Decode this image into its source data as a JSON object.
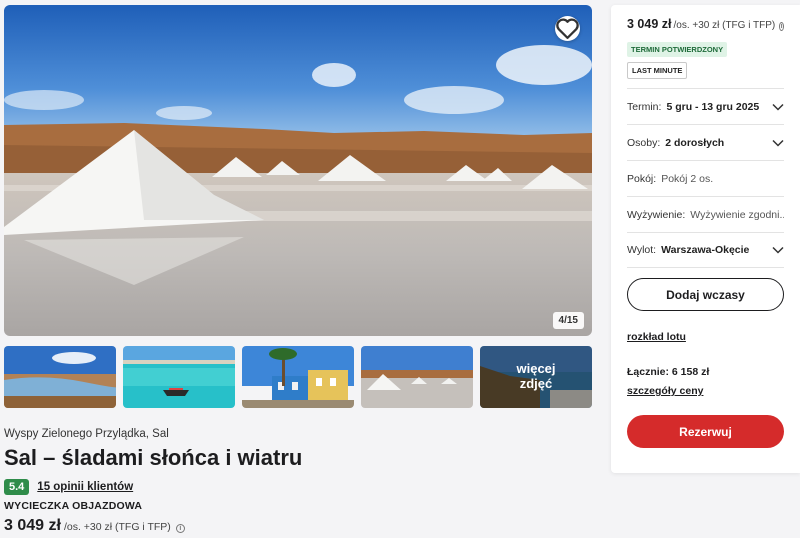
{
  "gallery": {
    "counter": "4/15",
    "more_photos_line1": "więcej",
    "more_photos_line2": "zdjęć"
  },
  "offer": {
    "location": "Wyspy Zielonego Przylądka, Sal",
    "title": "Sal – śladami słońca i wiatru",
    "rating": "5.4",
    "reviews_label": "15 opinii klientów",
    "trip_type": "WYCIECZKA OBJAZDOWA",
    "price": "3 049 zł",
    "price_suffix": "/os. +30 zł (TFG i TFP)"
  },
  "panel": {
    "price": "3 049 zł",
    "price_suffix": "/os. +30 zł (TFG i TFP)",
    "badge_confirmed": "TERMIN POTWIERDZONY",
    "badge_lastminute": "LAST MINUTE",
    "options": {
      "term": {
        "label": "Termin:",
        "value": "5 gru - 13 gru 2025"
      },
      "persons": {
        "label": "Osoby:",
        "value": "2 dorosłych"
      },
      "room": {
        "label": "Pokój:",
        "value": "Pokój 2 os."
      },
      "board": {
        "label": "Wyżywienie:",
        "value": "Wyżywienie zgodni..."
      },
      "departure": {
        "label": "Wylot:",
        "value": "Warszawa-Okęcie"
      }
    },
    "add_button": "Dodaj wczasy",
    "flight_schedule_link": "rozkład lotu",
    "total": "Łącznie: 6 158 zł",
    "price_details_link": "szczegóły ceny",
    "book_button": "Rezerwuj"
  },
  "colors": {
    "book_button": "#d52b2b",
    "rating_badge": "#2f8c4a",
    "confirmed_badge_bg": "#dff3e6"
  },
  "icons": [
    "heart-icon",
    "chevron-down-icon",
    "info-icon"
  ]
}
